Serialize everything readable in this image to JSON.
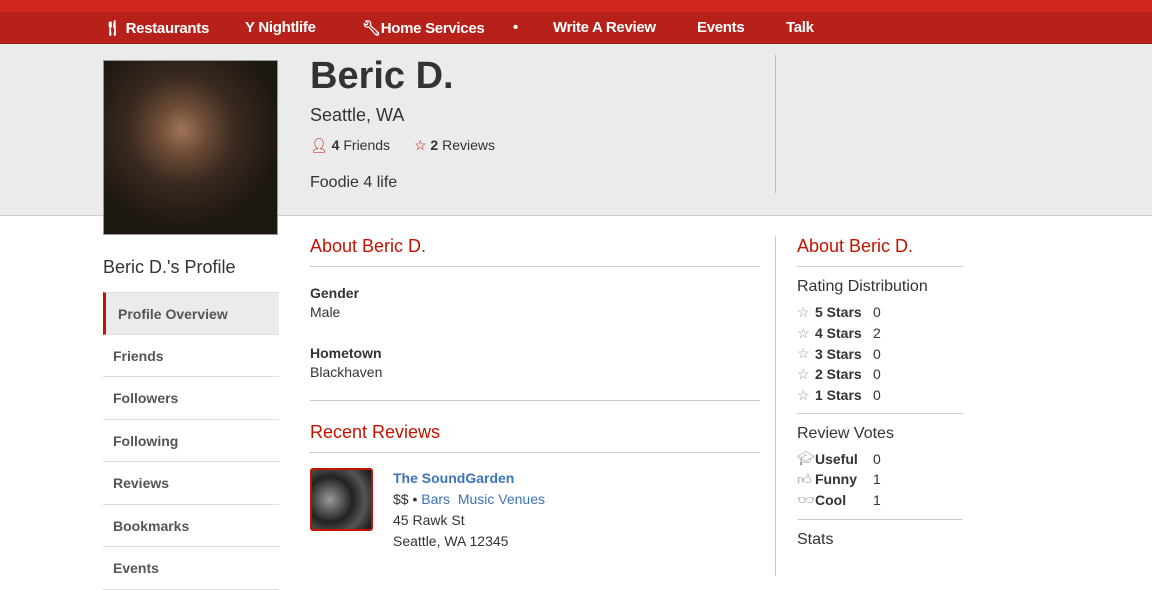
{
  "nav": [
    {
      "label": "Restaurants",
      "icon": "fork-knife-icon"
    },
    {
      "label": "Nightlife",
      "icon": "cocktail-icon"
    },
    {
      "label": "Home Services",
      "icon": "wrench-icon"
    },
    {
      "label": "•"
    },
    {
      "label": "Write A Review"
    },
    {
      "label": "Events"
    },
    {
      "label": "Talk"
    }
  ],
  "profile": {
    "name": "Beric D.",
    "location": "Seattle, WA",
    "friends_count": "4",
    "friends_label": "Friends",
    "reviews_count": "2",
    "reviews_label": "Reviews",
    "bio": "Foodie 4 life"
  },
  "sidebar": {
    "title": "Beric D.'s Profile",
    "items": [
      "Profile Overview",
      "Friends",
      "Followers",
      "Following",
      "Reviews",
      "Bookmarks",
      "Events"
    ]
  },
  "about": {
    "title": "About Beric D.",
    "gender_label": "Gender",
    "gender": "Male",
    "hometown_label": "Hometown",
    "hometown": "Blackhaven"
  },
  "recent": {
    "title": "Recent Reviews",
    "business": "The SoundGarden",
    "price": "$$",
    "sep": "•",
    "categories": [
      "Bars",
      "Music Venues"
    ],
    "address1": "45 Rawk St",
    "address2": "Seattle, WA 12345"
  },
  "right": {
    "title": "About Beric D.",
    "rating_title": "Rating Distribution",
    "ratings": [
      {
        "label": "5 Stars",
        "count": "0"
      },
      {
        "label": "4 Stars",
        "count": "2"
      },
      {
        "label": "3 Stars",
        "count": "0"
      },
      {
        "label": "2 Stars",
        "count": "0"
      },
      {
        "label": "1 Stars",
        "count": "0"
      }
    ],
    "votes_title": "Review Votes",
    "votes": [
      {
        "label": "Useful",
        "count": "0",
        "icon": "graduation-cap-icon"
      },
      {
        "label": "Funny",
        "count": "1",
        "icon": "thumbs-up-icon"
      },
      {
        "label": "Cool",
        "count": "1",
        "icon": "sunglasses-icon"
      }
    ],
    "stats_title": "Stats"
  },
  "colors": {
    "brand": "#c41200",
    "nav": "#b8201a",
    "link": "#3b74b8"
  }
}
